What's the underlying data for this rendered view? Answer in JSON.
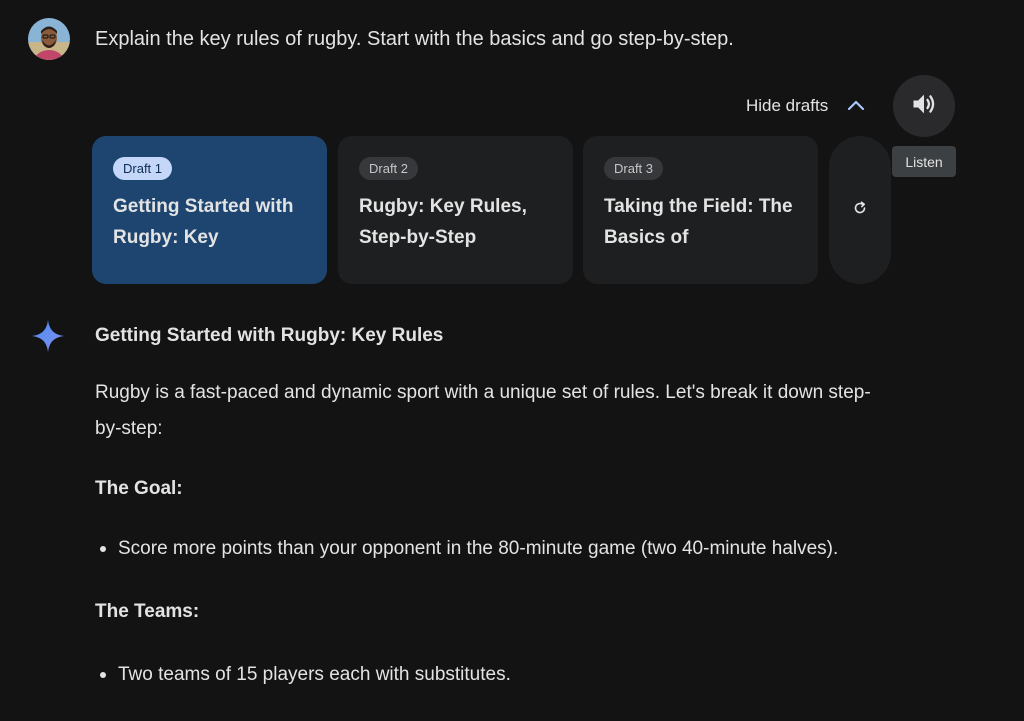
{
  "user": {
    "prompt": "Explain the key rules of rugby. Start with the basics and go step-by-step.",
    "avatar_icon": "user-avatar"
  },
  "drafts_bar": {
    "hide_label": "Hide drafts",
    "toggle_icon": "chevron-up-icon",
    "listen_icon": "volume-icon",
    "listen_tooltip": "Listen",
    "regenerate_icon": "refresh-icon",
    "drafts": [
      {
        "chip": "Draft 1",
        "title": "Getting Started with Rugby: Key",
        "selected": true
      },
      {
        "chip": "Draft 2",
        "title": "Rugby: Key Rules, Step-by-Step",
        "selected": false
      },
      {
        "chip": "Draft 3",
        "title": "Taking the Field: The Basics of",
        "selected": false
      }
    ]
  },
  "response": {
    "assistant_icon": "gemini-sparkle-icon",
    "title": "Getting Started with Rugby: Key Rules",
    "intro": "Rugby is a fast-paced and dynamic sport with a unique set of rules. Let's break it down step-by-step:",
    "sections": [
      {
        "heading": "The Goal:",
        "bullets": [
          "Score more points than your opponent in the 80-minute game (two 40-minute halves)."
        ]
      },
      {
        "heading": "The Teams:",
        "bullets": [
          "Two teams of 15 players each with substitutes."
        ]
      }
    ]
  },
  "colors": {
    "background": "#131314",
    "card": "#1e1f20",
    "selected_card": "#1d4570",
    "selected_chip": "#c4d7f8",
    "accent_blue": "#a8c7fa",
    "text": "#e3e3e3"
  }
}
